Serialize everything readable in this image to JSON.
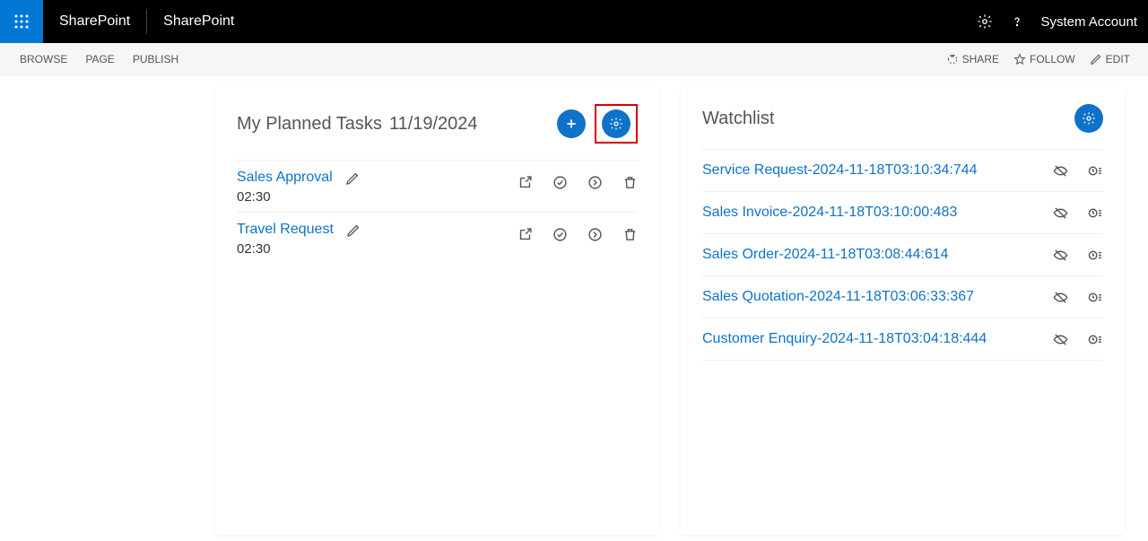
{
  "top": {
    "brand1": "SharePoint",
    "brand2": "SharePoint",
    "account": "System Account"
  },
  "ribbon": {
    "tabs": [
      "BROWSE",
      "PAGE",
      "PUBLISH"
    ],
    "actions": {
      "share": "SHARE",
      "follow": "FOLLOW",
      "edit": "EDIT"
    }
  },
  "tasks": {
    "title": "My Planned Tasks",
    "date": "11/19/2024",
    "items": [
      {
        "title": "Sales Approval",
        "time": "02:30"
      },
      {
        "title": "Travel Request",
        "time": "02:30"
      }
    ]
  },
  "watchlist": {
    "title": "Watchlist",
    "items": [
      {
        "title": "Service Request-2024-11-18T03:10:34:744"
      },
      {
        "title": "Sales Invoice-2024-11-18T03:10:00:483"
      },
      {
        "title": "Sales Order-2024-11-18T03:08:44:614"
      },
      {
        "title": "Sales Quotation-2024-11-18T03:06:33:367"
      },
      {
        "title": "Customer Enquiry-2024-11-18T03:04:18:444"
      }
    ]
  }
}
